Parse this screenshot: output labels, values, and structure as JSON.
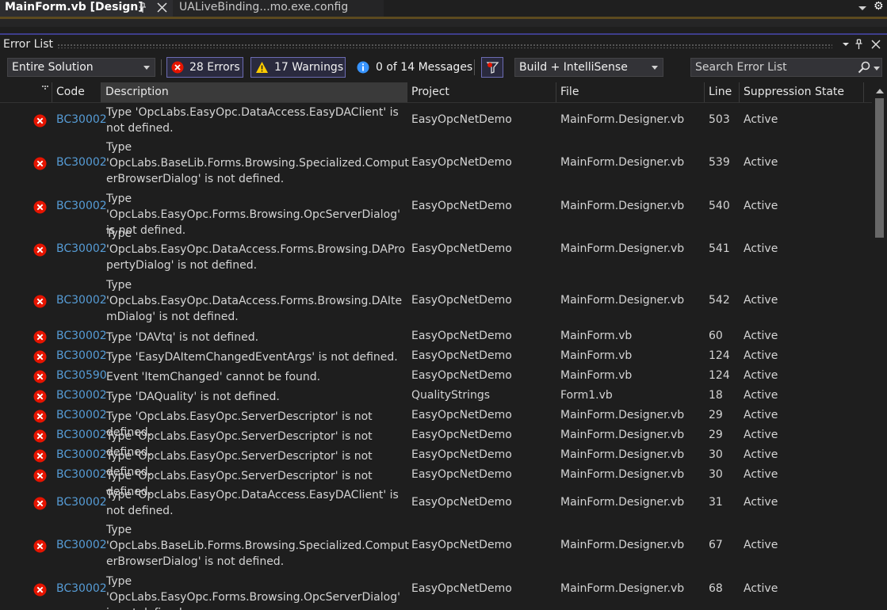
{
  "tabs": {
    "active": "MainForm.vb [Design]",
    "inactive": "UALiveBinding...mo.exe.config"
  },
  "panel": {
    "title": "Error List"
  },
  "toolbar": {
    "scope": "Entire Solution",
    "errors_label": "28 Errors",
    "warnings_label": "17 Warnings",
    "messages_label": "0 of 14 Messages",
    "source": "Build + IntelliSense",
    "search_placeholder": "Search Error List"
  },
  "columns": [
    "Code",
    "Description",
    "Project",
    "File",
    "Line",
    "Suppression State"
  ],
  "rows": [
    {
      "code": "BC30002",
      "desc": "Type 'OpcLabs.EasyOpc.DataAccess.EasyDAClient' is not defined.",
      "project": "EasyOpcNetDemo",
      "file": "MainForm.Designer.vb",
      "line": "503",
      "state": "Active"
    },
    {
      "code": "BC30002",
      "desc": "Type 'OpcLabs.BaseLib.Forms.Browsing.Specialized.ComputerBrowserDialog' is not defined.",
      "project": "EasyOpcNetDemo",
      "file": "MainForm.Designer.vb",
      "line": "539",
      "state": "Active"
    },
    {
      "code": "BC30002",
      "desc": "Type 'OpcLabs.EasyOpc.Forms.Browsing.OpcServerDialog' is not defined.",
      "project": "EasyOpcNetDemo",
      "file": "MainForm.Designer.vb",
      "line": "540",
      "state": "Active"
    },
    {
      "code": "BC30002",
      "desc": "Type 'OpcLabs.EasyOpc.DataAccess.Forms.Browsing.DAPropertyDialog' is not defined.",
      "project": "EasyOpcNetDemo",
      "file": "MainForm.Designer.vb",
      "line": "541",
      "state": "Active"
    },
    {
      "code": "BC30002",
      "desc": "Type 'OpcLabs.EasyOpc.DataAccess.Forms.Browsing.DAItemDialog' is not defined.",
      "project": "EasyOpcNetDemo",
      "file": "MainForm.Designer.vb",
      "line": "542",
      "state": "Active"
    },
    {
      "code": "BC30002",
      "desc": "Type 'DAVtq' is not defined.",
      "project": "EasyOpcNetDemo",
      "file": "MainForm.vb",
      "line": "60",
      "state": "Active"
    },
    {
      "code": "BC30002",
      "desc": "Type 'EasyDAItemChangedEventArgs' is not defined.",
      "project": "EasyOpcNetDemo",
      "file": "MainForm.vb",
      "line": "124",
      "state": "Active"
    },
    {
      "code": "BC30590",
      "desc": "Event 'ItemChanged' cannot be found.",
      "project": "EasyOpcNetDemo",
      "file": "MainForm.vb",
      "line": "124",
      "state": "Active"
    },
    {
      "code": "BC30002",
      "desc": "Type 'DAQuality' is not defined.",
      "project": "QualityStrings",
      "file": "Form1.vb",
      "line": "18",
      "state": "Active"
    },
    {
      "code": "BC30002",
      "desc": "Type 'OpcLabs.EasyOpc.ServerDescriptor' is not defined.",
      "project": "EasyOpcNetDemo",
      "file": "MainForm.Designer.vb",
      "line": "29",
      "state": "Active"
    },
    {
      "code": "BC30002",
      "desc": "Type 'OpcLabs.EasyOpc.ServerDescriptor' is not defined.",
      "project": "EasyOpcNetDemo",
      "file": "MainForm.Designer.vb",
      "line": "29",
      "state": "Active"
    },
    {
      "code": "BC30002",
      "desc": "Type 'OpcLabs.EasyOpc.ServerDescriptor' is not defined.",
      "project": "EasyOpcNetDemo",
      "file": "MainForm.Designer.vb",
      "line": "30",
      "state": "Active"
    },
    {
      "code": "BC30002",
      "desc": "Type 'OpcLabs.EasyOpc.ServerDescriptor' is not defined.",
      "project": "EasyOpcNetDemo",
      "file": "MainForm.Designer.vb",
      "line": "30",
      "state": "Active"
    },
    {
      "code": "BC30002",
      "desc": "Type 'OpcLabs.EasyOpc.DataAccess.EasyDAClient' is not defined.",
      "project": "EasyOpcNetDemo",
      "file": "MainForm.Designer.vb",
      "line": "31",
      "state": "Active"
    },
    {
      "code": "BC30002",
      "desc": "Type 'OpcLabs.BaseLib.Forms.Browsing.Specialized.ComputerBrowserDialog' is not defined.",
      "project": "EasyOpcNetDemo",
      "file": "MainForm.Designer.vb",
      "line": "67",
      "state": "Active"
    },
    {
      "code": "BC30002",
      "desc": "Type 'OpcLabs.EasyOpc.Forms.Browsing.OpcServerDialog' is not defined.",
      "project": "EasyOpcNetDemo",
      "file": "MainForm.Designer.vb",
      "line": "68",
      "state": "Active"
    }
  ]
}
